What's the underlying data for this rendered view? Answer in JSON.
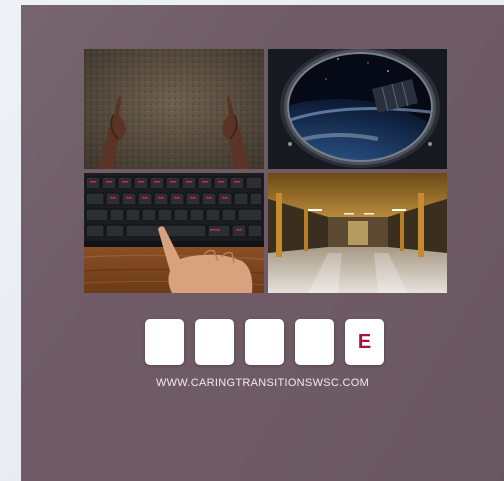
{
  "puzzle": {
    "answer_slots": [
      "",
      "",
      "",
      "",
      "E"
    ],
    "clue_images": [
      {
        "name": "hands-on-soil-image"
      },
      {
        "name": "earth-through-spaceship-window-image"
      },
      {
        "name": "hand-on-keyboard-image"
      },
      {
        "name": "empty-parking-garage-image"
      }
    ]
  },
  "footer": {
    "website": "WWW.CARINGTRANSITIONSWSC.COM"
  },
  "colors": {
    "panel": "#6e5b66",
    "slot_background": "#ffffff",
    "revealed_letter": "#a3143a",
    "footer_text": "#f1eaee"
  }
}
